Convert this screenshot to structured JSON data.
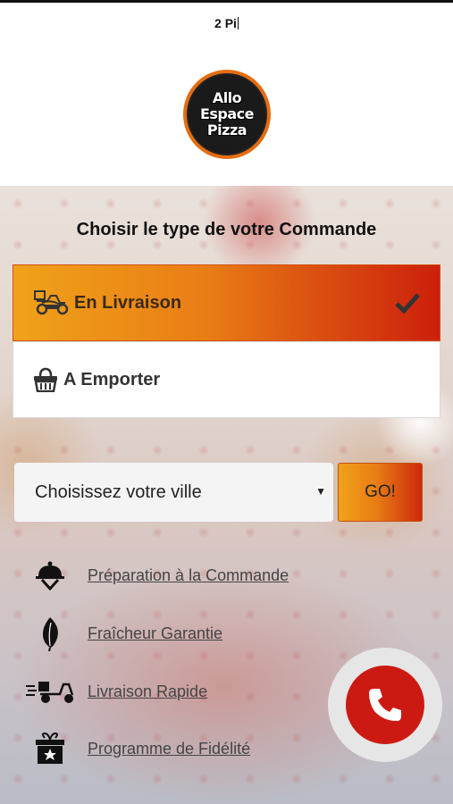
{
  "status_text": "2 Pi",
  "logo": {
    "line1": "Allo",
    "line2": "Espace",
    "line3": "Pizza"
  },
  "order_section": {
    "title": "Choisir le type de votre Commande",
    "options": [
      {
        "label": "En Livraison",
        "icon": "scooter-icon",
        "selected": true
      },
      {
        "label": "A Emporter",
        "icon": "basket-icon",
        "selected": false
      }
    ]
  },
  "city_select": {
    "value": "Choisissez votre ville",
    "go_label": "GO!"
  },
  "features": [
    {
      "label": "Préparation à la Commande",
      "icon": "cloche-icon"
    },
    {
      "label": "Fraîcheur Garantie",
      "icon": "leaf-icon"
    },
    {
      "label": "Livraison Rapide",
      "icon": "fast-scooter-icon"
    },
    {
      "label": "Programme de Fidélité",
      "icon": "gift-icon"
    }
  ],
  "colors": {
    "accent_start": "#f0a21a",
    "accent_end": "#cc1f0c",
    "call_button": "#cc1a12"
  }
}
